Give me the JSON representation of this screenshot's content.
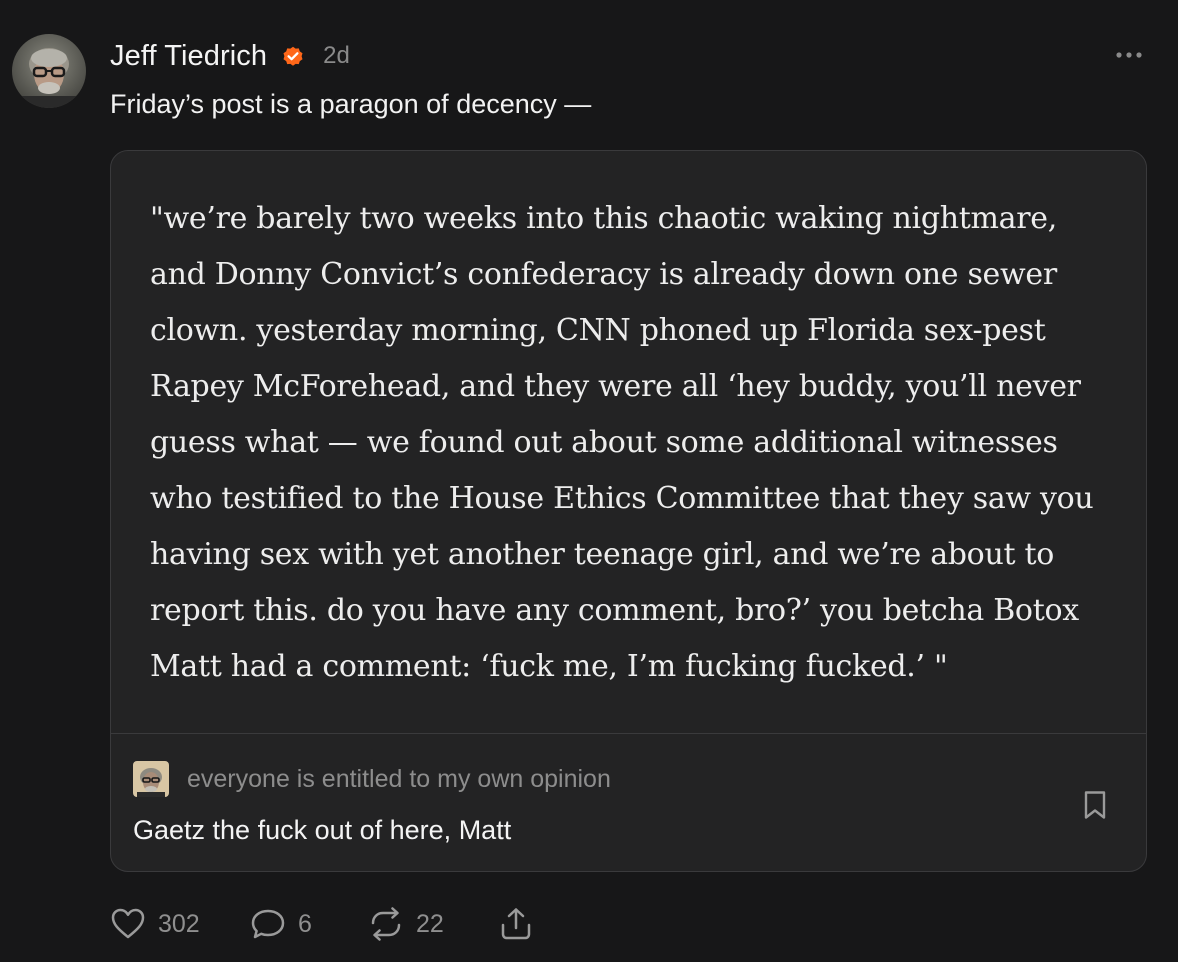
{
  "note": {
    "author_name": "Jeff Tiedrich",
    "timestamp": "2d",
    "text": "Friday’s post is a paragon of decency —",
    "icons": {
      "verified": "verified-badge-icon",
      "more": "more-dots-icon"
    },
    "colors": {
      "verified_badge": "#ff6719"
    }
  },
  "quote": {
    "lines": [
      "\"we’re barely two weeks into this chaotic waking nightmare,",
      "and Donny Convict’s confederacy is already down one sewer",
      "clown. yesterday morning, CNN phoned up Florida sex-pest",
      "Rapey McForehead, and they were all ‘hey buddy, you’ll never",
      "guess what — we found out about some additional witnesses",
      "who testified to the House Ethics Committee that they saw you",
      "having sex with yet another teenage girl, and we’re about to",
      "report this. do you have any comment, bro?’ you betcha Botox",
      "Matt had a comment: ‘fuck me, I’m fucking fucked.’ \""
    ],
    "publication_name": "everyone is entitled to my own opinion",
    "post_title": "Gaetz the fuck out of here, Matt"
  },
  "actions": {
    "likes": "302",
    "comments": "6",
    "restacks": "22",
    "icons": [
      "heart-icon",
      "comment-bubble-icon",
      "restack-icon",
      "share-icon",
      "bookmark-icon"
    ]
  }
}
